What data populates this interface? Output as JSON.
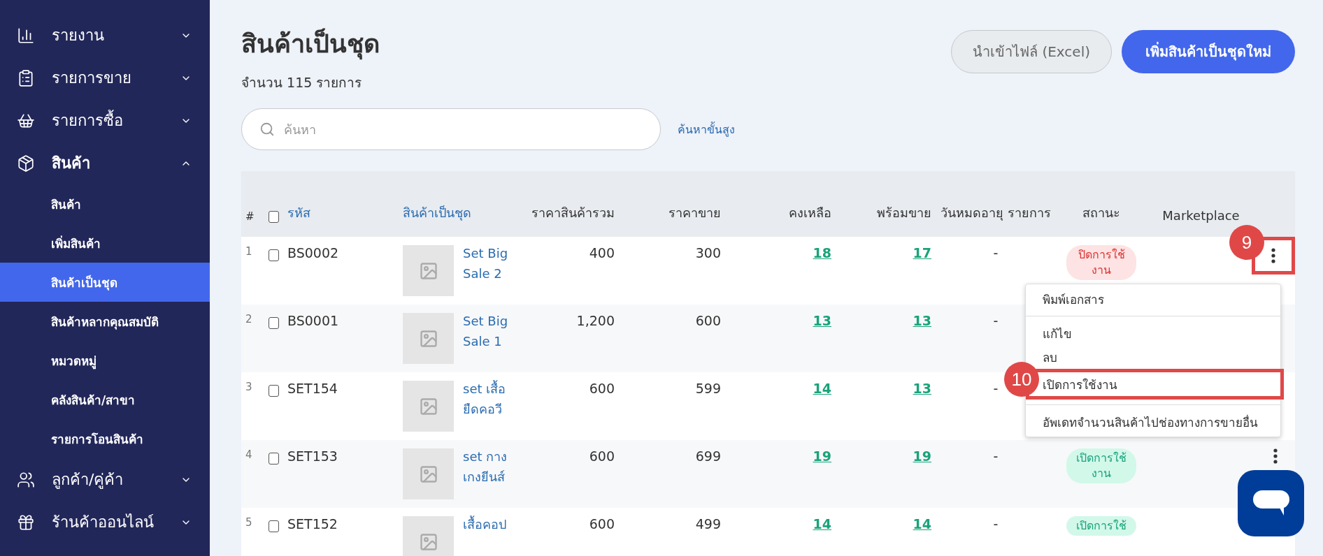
{
  "sidebar": {
    "items": [
      {
        "label": "รายงาน",
        "expanded": false
      },
      {
        "label": "รายการขาย",
        "expanded": false
      },
      {
        "label": "รายการซื้อ",
        "expanded": false
      },
      {
        "label": "สินค้า",
        "expanded": true,
        "children": [
          {
            "label": "สินค้า",
            "selected": false
          },
          {
            "label": "เพิ่มสินค้า",
            "selected": false
          },
          {
            "label": "สินค้าเป็นชุด",
            "selected": true
          },
          {
            "label": "สินค้าหลากคุณสมบัติ",
            "selected": false
          },
          {
            "label": "หมวดหมู่",
            "selected": false
          },
          {
            "label": "คลังสินค้า/สาขา",
            "selected": false
          },
          {
            "label": "รายการโอนสินค้า",
            "selected": false
          }
        ]
      },
      {
        "label": "ลูกค้า/คู่ค้า",
        "expanded": false
      },
      {
        "label": "ร้านค้าออนไลน์",
        "expanded": false
      }
    ]
  },
  "page": {
    "title": "สินค้าเป็นชุด",
    "count": "จำนวน 115 รายการ",
    "import_button": "นำเข้าไฟล์ (Excel)",
    "add_button": "เพิ่มสินค้าเป็นชุดใหม่"
  },
  "search": {
    "placeholder": "ค้นหา",
    "advanced_link": "ค้นหาขั้นสูง"
  },
  "table": {
    "select_all_checked": false,
    "columns": [
      {
        "label": "#",
        "sortable": false
      },
      {
        "label": "รหัส",
        "sortable": true
      },
      {
        "label": "สินค้าเป็นชุด",
        "sortable": true
      },
      {
        "label": "ราคาสินค้ารวม",
        "sortable": false
      },
      {
        "label": "ราคาขาย",
        "sortable": false
      },
      {
        "label": "คงเหลือ",
        "sortable": false
      },
      {
        "label": "พร้อมขาย",
        "sortable": false
      },
      {
        "label": "วันหมดอายุ รายการ",
        "sortable": false
      },
      {
        "label": "สถานะ",
        "sortable": false
      },
      {
        "label": "Marketplace",
        "sortable": false
      }
    ],
    "rows": [
      {
        "index": "1",
        "checked": false,
        "code": "BS0002",
        "name": "Set Big Sale 2",
        "total": "400",
        "price": "300",
        "stock": "18",
        "ready": "17",
        "expiry": "-",
        "status": {
          "kind": "off",
          "label": "ปิดการใช้งาน"
        }
      },
      {
        "index": "2",
        "checked": false,
        "code": "BS0001",
        "name": "Set Big Sale 1",
        "total": "1,200",
        "price": "600",
        "stock": "13",
        "ready": "13",
        "expiry": "-"
      },
      {
        "index": "3",
        "checked": false,
        "code": "SET154",
        "name": "set เสื้อ ยืดคอวี",
        "total": "600",
        "price": "599",
        "stock": "14",
        "ready": "13",
        "expiry": "-"
      },
      {
        "index": "4",
        "checked": false,
        "code": "SET153",
        "name": "set กาง เกงยีนส์",
        "total": "600",
        "price": "699",
        "stock": "19",
        "ready": "19",
        "expiry": "-",
        "status": {
          "kind": "on",
          "label": "เปิดการใช้งาน"
        }
      },
      {
        "index": "5",
        "checked": false,
        "code": "SET152",
        "name": "เสื้อคอป",
        "total": "600",
        "price": "499",
        "stock": "14",
        "ready": "14",
        "expiry": "-",
        "status": {
          "kind": "on",
          "label": "เปิดการใช้"
        }
      }
    ]
  },
  "row_menu": {
    "items": [
      {
        "kind": "item",
        "label": "พิมพ์เอกสาร",
        "highlighted": false
      },
      {
        "kind": "divider"
      },
      {
        "kind": "item",
        "label": "แก้ไข",
        "highlighted": false
      },
      {
        "kind": "item",
        "label": "ลบ",
        "highlighted": false
      },
      {
        "kind": "item",
        "label": "เปิดการใช้งาน",
        "highlighted": true
      },
      {
        "kind": "divider"
      },
      {
        "kind": "item",
        "label": "อัพเดทจำนวนสินค้าไปช่องทางการขายอื่น",
        "highlighted": false
      }
    ]
  },
  "annotations": [
    {
      "label": "9"
    },
    {
      "label": "10"
    }
  ]
}
